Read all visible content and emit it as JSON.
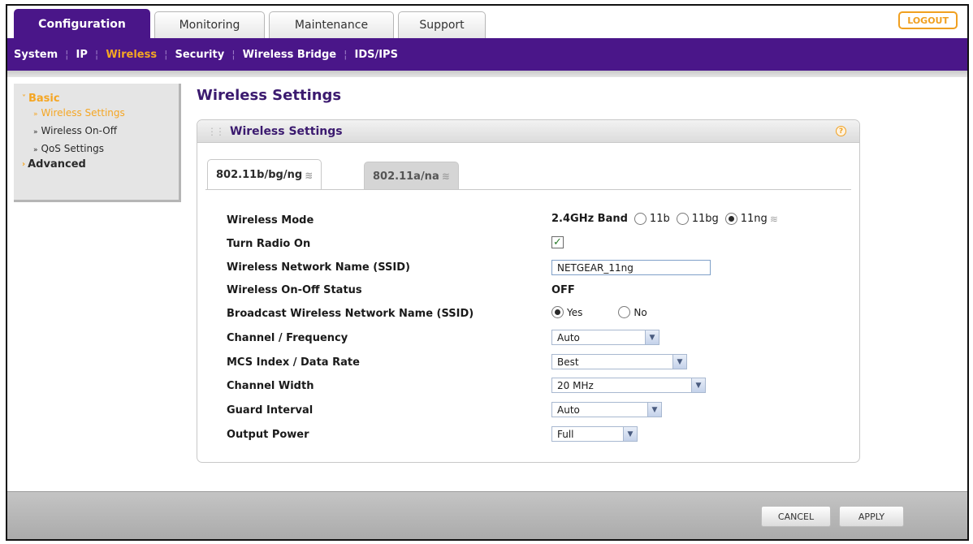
{
  "top_tabs": [
    {
      "label": "Configuration",
      "active": true
    },
    {
      "label": "Monitoring",
      "active": false
    },
    {
      "label": "Maintenance",
      "active": false
    },
    {
      "label": "Support",
      "active": false
    }
  ],
  "logout_label": "LOGOUT",
  "submenu": [
    {
      "label": "System",
      "active": false
    },
    {
      "label": "IP",
      "active": false
    },
    {
      "label": "Wireless",
      "active": true
    },
    {
      "label": "Security",
      "active": false
    },
    {
      "label": "Wireless Bridge",
      "active": false
    },
    {
      "label": "IDS/IPS",
      "active": false
    }
  ],
  "leftnav": {
    "basic": "Basic",
    "items": [
      "Wireless Settings",
      "Wireless On-Off",
      "QoS Settings"
    ],
    "advanced": "Advanced"
  },
  "page_title": "Wireless Settings",
  "panel": {
    "title": "Wireless Settings",
    "help_symbol": "?",
    "band_tabs": [
      "802.11b/bg/ng",
      "802.11a/na"
    ]
  },
  "fields": {
    "wireless_mode": {
      "label": "Wireless Mode",
      "band": "2.4GHz Band",
      "options": [
        "11b",
        "11bg",
        "11ng"
      ],
      "selected": "11ng"
    },
    "radio_on": {
      "label": "Turn Radio On",
      "checked": true
    },
    "ssid": {
      "label": "Wireless Network Name (SSID)",
      "value": "NETGEAR_11ng"
    },
    "onoff_status": {
      "label": "Wireless On-Off Status",
      "value": "OFF"
    },
    "broadcast": {
      "label": "Broadcast Wireless Network Name (SSID)",
      "options": [
        "Yes",
        "No"
      ],
      "selected": "Yes"
    },
    "channel": {
      "label": "Channel / Frequency",
      "value": "Auto"
    },
    "mcs": {
      "label": "MCS Index / Data Rate",
      "value": "Best"
    },
    "channel_width": {
      "label": "Channel Width",
      "value": "20 MHz"
    },
    "guard_interval": {
      "label": "Guard Interval",
      "value": "Auto"
    },
    "output_power": {
      "label": "Output Power",
      "value": "Full"
    }
  },
  "buttons": {
    "cancel": "CANCEL",
    "apply": "APPLY"
  },
  "colors": {
    "brand_purple": "#4a1689",
    "accent_orange": "#f5a623"
  }
}
